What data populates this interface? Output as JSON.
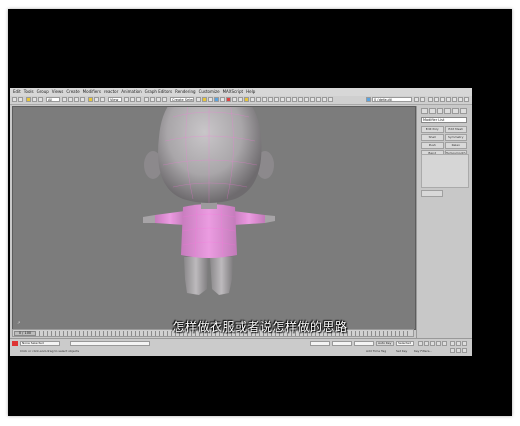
{
  "menu": [
    "Edit",
    "Tools",
    "Group",
    "Views",
    "Create",
    "Modifiers",
    "reactor",
    "Animation",
    "Graph Editors",
    "Rendering",
    "Customize",
    "MAXScript",
    "Help"
  ],
  "toolbar": {
    "selection_filter": "All",
    "view_dropdown": "View",
    "selection_set": "Create Selection Set",
    "layer": "0 (default)"
  },
  "viewport": {
    "label": "Perspective"
  },
  "command_panel": {
    "modifier_list": "Modifier List",
    "buttons": [
      "Edit Poly",
      "Edit Mesh",
      "Shell",
      "Symmetry",
      "Push",
      "Relax",
      "Bend",
      "Turbosmooth",
      "Smooth",
      "MeshSmooth"
    ]
  },
  "timeline": {
    "frame_label": "0 / 100"
  },
  "status": {
    "selection": "None Selected",
    "prompt": "Click or click-and-drag to select objects",
    "mode_label": "Selected",
    "add_time_tag": "Add Time Tag",
    "key_filters": "Key Filters...",
    "set_key": "Set Key",
    "auto_key": "Auto Key"
  },
  "subtitle": "怎样做衣服或者说怎样做的思路",
  "colors": {
    "viewport_bg": "#7c7c7c",
    "shirt": "#e18fd6",
    "skin": "#b7b4b7",
    "wire": "#ff6fe0"
  }
}
